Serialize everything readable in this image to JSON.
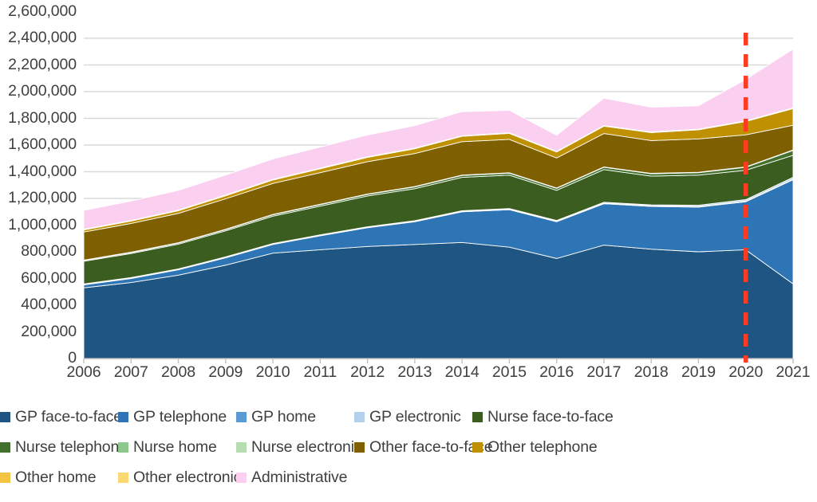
{
  "chart_data": {
    "type": "area",
    "stacked": true,
    "title": "",
    "subtitle": "",
    "xlabel": "",
    "ylabel": "",
    "categories": [
      "2006",
      "2007",
      "2008",
      "2009",
      "2010",
      "2011",
      "2012",
      "2013",
      "2014",
      "2015",
      "2016",
      "2017",
      "2018",
      "2019",
      "2020",
      "2021"
    ],
    "ylim": [
      0,
      2600000
    ],
    "ytick_labels": [
      "0",
      "200,000",
      "400,000",
      "600,000",
      "800,000",
      "1,000,000",
      "1,200,000",
      "1,400,000",
      "1,600,000",
      "1,800,000",
      "2,000,000",
      "2,200,000",
      "2,400,000",
      "2,600,000"
    ],
    "ytick_values": [
      0,
      200000,
      400000,
      600000,
      800000,
      1000000,
      1200000,
      1400000,
      1600000,
      1800000,
      2000000,
      2200000,
      2400000,
      2600000
    ],
    "ytick_interval": 200000,
    "grid": true,
    "grid_color": "#d9d9d9",
    "legend_position": "bottom",
    "annotations": [
      {
        "name": "pandemic-marker",
        "type": "vertical-line",
        "x": "2020",
        "color": "#FF3B21",
        "style": "dashed"
      }
    ],
    "series": [
      {
        "name": "GP face-to-face",
        "color": "#1F5582",
        "values": [
          530000,
          570000,
          625000,
          700000,
          790000,
          815000,
          840000,
          855000,
          870000,
          835000,
          750000,
          850000,
          820000,
          800000,
          815000,
          560000
        ]
      },
      {
        "name": "GP telephone",
        "color": "#2E75B6",
        "values": [
          22000,
          30000,
          40000,
          55000,
          65000,
          105000,
          140000,
          170000,
          230000,
          280000,
          275000,
          310000,
          320000,
          335000,
          360000,
          780000
        ]
      },
      {
        "name": "GP home",
        "color": "#5B9BD5",
        "values": [
          4000,
          4000,
          4000,
          4000,
          4000,
          4000,
          4000,
          4000,
          4000,
          4000,
          4000,
          4000,
          4000,
          4000,
          4000,
          4000
        ]
      },
      {
        "name": "GP electronic",
        "color": "#B4D0EA",
        "values": [
          3000,
          3000,
          3000,
          3000,
          3000,
          3000,
          4000,
          4000,
          4000,
          5000,
          6000,
          7000,
          8000,
          10000,
          12000,
          14000
        ]
      },
      {
        "name": "Nurse face-to-face",
        "color": "#3B5E20",
        "values": [
          170000,
          180000,
          185000,
          195000,
          205000,
          215000,
          230000,
          240000,
          250000,
          250000,
          225000,
          245000,
          215000,
          225000,
          220000,
          165000
        ]
      },
      {
        "name": "Nurse telephone",
        "color": "#44702D",
        "values": [
          6000,
          7000,
          8000,
          9000,
          10000,
          11000,
          12000,
          13000,
          14000,
          15000,
          15000,
          17000,
          18000,
          19000,
          22000,
          36000
        ]
      },
      {
        "name": "Nurse home",
        "color": "#8CC78C",
        "values": [
          2000,
          2000,
          2000,
          2000,
          2000,
          2000,
          2000,
          2000,
          2000,
          2000,
          2000,
          2000,
          2000,
          2000,
          2000,
          2000
        ]
      },
      {
        "name": "Nurse electronic",
        "color": "#B6DDB0",
        "values": [
          1000,
          1000,
          1000,
          1000,
          1000,
          1000,
          1000,
          1000,
          1000,
          1000,
          1000,
          1000,
          1000,
          1000,
          1500,
          2000
        ]
      },
      {
        "name": "Other face-to-face",
        "color": "#7F6000",
        "values": [
          210000,
          215000,
          220000,
          228000,
          232000,
          237000,
          242000,
          247000,
          250000,
          250000,
          225000,
          250000,
          245000,
          250000,
          240000,
          185000
        ]
      },
      {
        "name": "Other telephone",
        "color": "#BF9000",
        "values": [
          16000,
          18000,
          20000,
          23000,
          26000,
          29000,
          32000,
          36000,
          40000,
          45000,
          45000,
          55000,
          60000,
          68000,
          100000,
          125000
        ]
      },
      {
        "name": "Other home",
        "color": "#F5C342",
        "values": [
          3000,
          3000,
          3000,
          3000,
          3000,
          3000,
          3000,
          3000,
          3000,
          3000,
          3000,
          3000,
          3000,
          3000,
          3000,
          3000
        ]
      },
      {
        "name": "Other electronic",
        "color": "#FBD872",
        "values": [
          2000,
          2000,
          2000,
          2000,
          2000,
          2000,
          2000,
          2000,
          2000,
          2000,
          2000,
          2000,
          2000,
          2000,
          2500,
          3000
        ]
      },
      {
        "name": "Administrative",
        "color": "#FBCFF0",
        "values": [
          141000,
          145000,
          147000,
          150000,
          153000,
          158000,
          163000,
          168000,
          180000,
          168000,
          120000,
          205000,
          185000,
          175000,
          310000,
          440000
        ]
      }
    ]
  },
  "legend": {
    "rows": [
      [
        {
          "label": "GP face-to-face",
          "color": "#1F5582"
        },
        {
          "label": "GP telephone",
          "color": "#2E75B6"
        },
        {
          "label": "GP home",
          "color": "#5B9BD5"
        },
        {
          "label": "GP electronic",
          "color": "#B4D0EA"
        },
        {
          "label": "Nurse face-to-face",
          "color": "#3B5E20"
        }
      ],
      [
        {
          "label": "Nurse telephone",
          "color": "#44702D"
        },
        {
          "label": "Nurse home",
          "color": "#8CC78C"
        },
        {
          "label": "Nurse electronic",
          "color": "#B6DDB0"
        },
        {
          "label": "Other face-to-face",
          "color": "#7F6000"
        },
        {
          "label": "Other telephone",
          "color": "#BF9000"
        }
      ],
      [
        {
          "label": "Other home",
          "color": "#F5C342"
        },
        {
          "label": "Other electronic",
          "color": "#FBD872"
        },
        {
          "label": "Administrative",
          "color": "#FBCFF0"
        }
      ]
    ]
  }
}
